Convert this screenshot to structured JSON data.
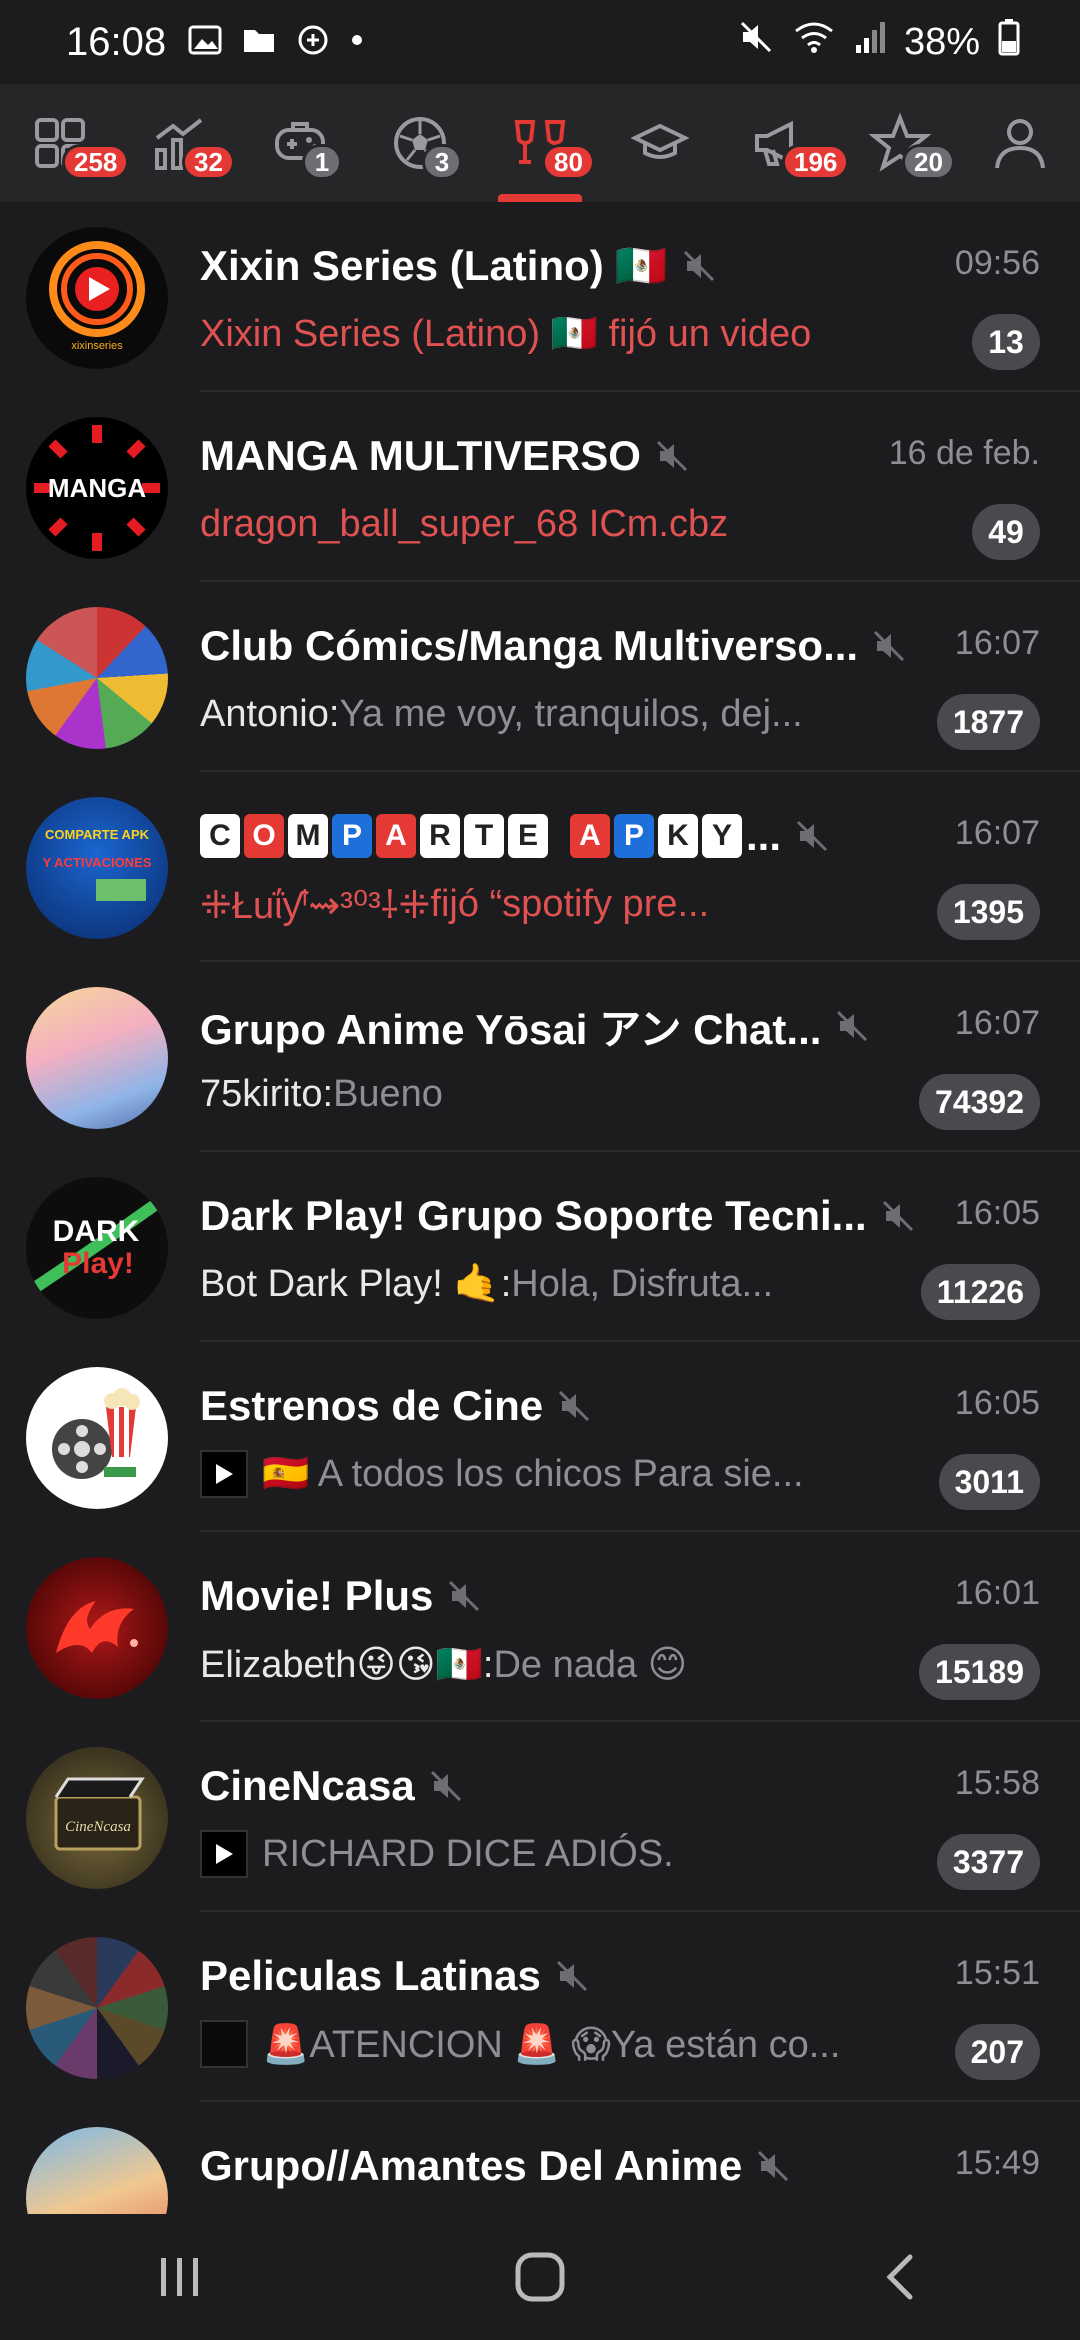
{
  "status_bar": {
    "time": "16:08",
    "battery": "38%"
  },
  "tabs": [
    {
      "icon": "all-chats-icon",
      "badge": "258",
      "badge_style": "red"
    },
    {
      "icon": "chart-icon",
      "badge": "32",
      "badge_style": "red"
    },
    {
      "icon": "gamepad-icon",
      "badge": "1",
      "badge_style": "grey"
    },
    {
      "icon": "soccer-ball-icon",
      "badge": "3",
      "badge_style": "grey"
    },
    {
      "icon": "cheers-icon",
      "badge": "80",
      "badge_style": "red",
      "active": true
    },
    {
      "icon": "graduation-cap-icon",
      "badge": "",
      "badge_style": ""
    },
    {
      "icon": "megaphone-icon",
      "badge": "196",
      "badge_style": "red"
    },
    {
      "icon": "star-icon",
      "badge": "20",
      "badge_style": "grey"
    },
    {
      "icon": "user-icon",
      "badge": "",
      "badge_style": ""
    }
  ],
  "chats": [
    {
      "title": "Xixin Series (Latino) 🇲🇽",
      "time": "09:56",
      "sender": "",
      "preview": "Xixin Series (Latino) 🇲🇽 fijó un video",
      "preview_red": true,
      "unread": "13"
    },
    {
      "title": "MANGA MULTIVERSO",
      "time": "16 de feb.",
      "sender": "",
      "preview": "dragon_ball_super_68 ICm.cbz",
      "preview_red": true,
      "unread": "49"
    },
    {
      "title": "Club Cómics/Manga Multiverso...",
      "time": "16:07",
      "sender": "Antonio: ",
      "preview": "Ya me voy, tranquilos, dej...",
      "preview_red": false,
      "unread": "1877"
    },
    {
      "title": "C O M P A R T E A P K Y...",
      "time": "16:07",
      "sender": "",
      "preview": "⁜ŁuΐƴⁱFIJÓ “spotify pre...",
      "preview_red": true,
      "unread": "1395"
    },
    {
      "title": "Grupo Anime Yōsai アン Chat...",
      "time": "16:07",
      "sender": "75kirito: ",
      "preview": "Bueno",
      "preview_red": false,
      "unread": "74392"
    },
    {
      "title": "Dark Play! Grupo Soporte Tecni...",
      "time": "16:05",
      "sender": "Bot Dark Play! 🤙: ",
      "preview": "Hola, Disfruta...",
      "preview_red": false,
      "unread": "11226"
    },
    {
      "title": "Estrenos de Cine",
      "time": "16:05",
      "sender": "",
      "preview": "🇪🇸 A todos los chicos Para sie...",
      "preview_red": false,
      "unread": "3011"
    },
    {
      "title": "Movie! Plus",
      "time": "16:01",
      "sender": "Elizabeth😜😘🇲🇽: ",
      "preview": "De nada 😊",
      "preview_red": false,
      "unread": "15189"
    },
    {
      "title": "CineNcasa",
      "time": "15:58",
      "sender": "",
      "preview": "RICHARD DICE ADIÓS.",
      "preview_red": false,
      "unread": "3377"
    },
    {
      "title": "Peliculas Latinas",
      "time": "15:51",
      "sender": "",
      "preview": "🚨ATENCION 🚨 😱Ya están co...",
      "preview_red": false,
      "unread": "207"
    },
    {
      "title": "Grupo//Amantes Del Anime",
      "time": "15:49",
      "sender": "",
      "preview": "",
      "preview_red": false,
      "unread": ""
    }
  ],
  "chat4": {
    "title_letters": [
      "C",
      "O",
      "M",
      "P",
      "A",
      "R",
      "T",
      "E",
      "A",
      "P",
      "K",
      "Y"
    ],
    "title_suffix": "...",
    "preview_name": "⁜Łuΐƴⁱ⇝³⁰³⸸⁜",
    "preview_action": " fijó “spotify pre..."
  },
  "avatars": {
    "xixin_text": "xixinseries",
    "manga_text": "MANGA",
    "comparte_text": "COMPARTE APK",
    "activaciones_text": "Y ACTIVACIONES",
    "dark_text": "DARK",
    "play_text": "Play!",
    "cinencasa_text": "CineNcasa"
  },
  "colors": {
    "accent": "#e53935",
    "background": "#1c1c1e",
    "tab_bar": "#262628",
    "preview_red": "#e05252",
    "muted": "#8e8e93"
  }
}
